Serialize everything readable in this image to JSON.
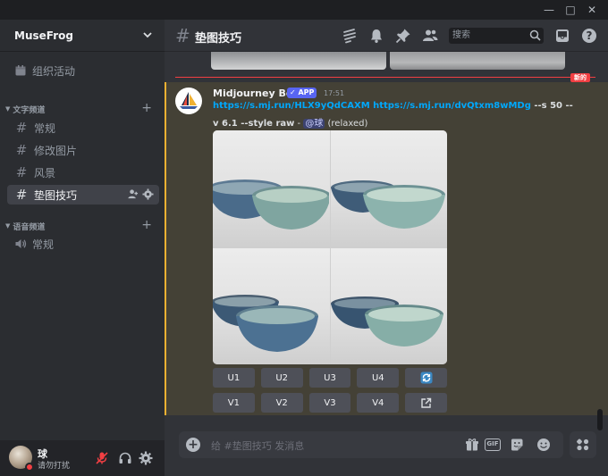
{
  "window": {
    "minimize": "—",
    "maximize": "□",
    "close": "✕"
  },
  "server": {
    "name": "MuseFrog"
  },
  "sidebar": {
    "events_label": "组织活动",
    "text_category": "文字频道",
    "text_channels": [
      "常规",
      "修改图片",
      "风景",
      "垫图技巧"
    ],
    "voice_category": "语音频道",
    "voice_channels": [
      "常规"
    ]
  },
  "user": {
    "name": "球",
    "status": "请勿打扰"
  },
  "header": {
    "channel": "垫图技巧",
    "search_placeholder": "搜索"
  },
  "divider": {
    "new_label": "新的"
  },
  "message": {
    "author": "Midjourney Bot",
    "badge": "✓ APP",
    "time": "17:51",
    "link1": "https://s.mj.run/HLX9yQdCAXM",
    "link2": "https://s.mj.run/dvQtxm8wMDg",
    "params1": "--s 50 --",
    "params2": "v 6.1 --style raw",
    "separator": " - ",
    "mention": "@球",
    "mode": "(relaxed)",
    "upscale_buttons": [
      "U1",
      "U2",
      "U3",
      "U4"
    ],
    "variation_buttons": [
      "V1",
      "V2",
      "V3",
      "V4"
    ]
  },
  "composer": {
    "placeholder": "给 #垫图技巧 发消息",
    "gif_label": "GIF"
  },
  "colors": {
    "accent": "#5865f2",
    "mention_bar": "#f0b132",
    "link": "#00a8fc",
    "new_line": "#f23f43"
  }
}
